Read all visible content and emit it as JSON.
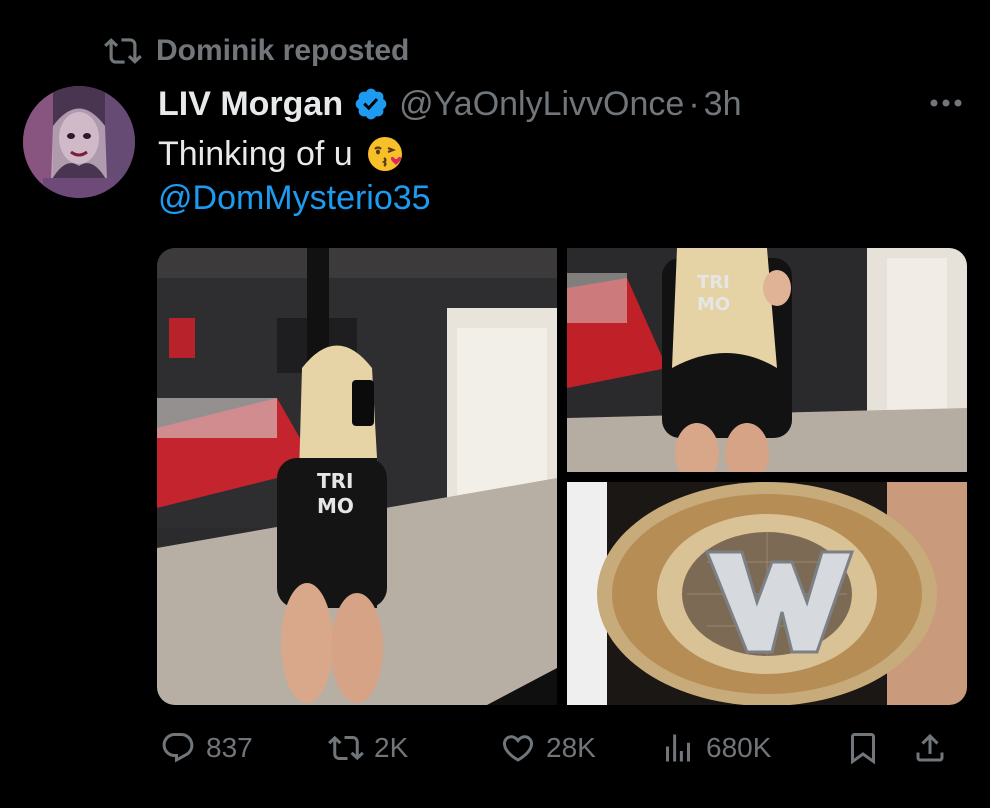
{
  "repost": {
    "icon": "repost-icon",
    "text": "Dominik reposted"
  },
  "tweet": {
    "avatar_icon": "profile-avatar",
    "display_name": "LIV Morgan",
    "verified_icon": "verified-badge-icon",
    "verified_color": "#1d9bf0",
    "handle": "@YaOnlyLivvOnce",
    "separator": "·",
    "time": "3h",
    "more_icon": "more-options-icon",
    "text_line1": "Thinking of u",
    "emoji": "kissing-face-emoji",
    "mention": "@DomMysterio35",
    "mention_color": "#1d9bf0"
  },
  "media": [
    {
      "name": "selfie-photo"
    },
    {
      "name": "shirt-photo"
    },
    {
      "name": "championship-belt-photo"
    }
  ],
  "actions": {
    "reply": {
      "icon": "reply-icon",
      "count": "837"
    },
    "repost": {
      "icon": "repost-icon",
      "count": "2K"
    },
    "like": {
      "icon": "heart-icon",
      "count": "28K"
    },
    "views": {
      "icon": "views-icon",
      "count": "680K"
    },
    "bookmark": {
      "icon": "bookmark-icon"
    },
    "share": {
      "icon": "share-icon"
    }
  },
  "colors": {
    "background": "#000000",
    "primary_text": "#e7e9ea",
    "secondary_text": "#71767b",
    "accent": "#1d9bf0"
  }
}
